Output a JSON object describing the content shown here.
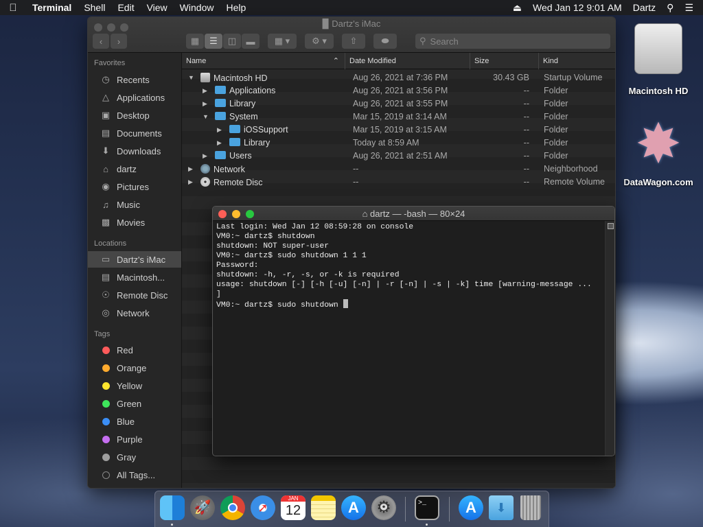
{
  "menubar": {
    "app": "Terminal",
    "items": [
      "Shell",
      "Edit",
      "View",
      "Window",
      "Help"
    ],
    "clock": "Wed Jan 12  9:01 AM",
    "user": "Dartz"
  },
  "finder": {
    "title": "Dartz's iMac",
    "search_placeholder": "Search",
    "sidebar": {
      "favorites_label": "Favorites",
      "favorites": [
        "Recents",
        "Applications",
        "Desktop",
        "Documents",
        "Downloads",
        "dartz",
        "Pictures",
        "Music",
        "Movies"
      ],
      "locations_label": "Locations",
      "locations": [
        "Dartz's iMac",
        "Macintosh...",
        "Remote Disc",
        "Network"
      ],
      "tags_label": "Tags",
      "tags": [
        {
          "name": "Red",
          "color": "#ff5b5b"
        },
        {
          "name": "Orange",
          "color": "#ffab2e"
        },
        {
          "name": "Yellow",
          "color": "#ffe52e"
        },
        {
          "name": "Green",
          "color": "#3ee65b"
        },
        {
          "name": "Blue",
          "color": "#3b8ef5"
        },
        {
          "name": "Purple",
          "color": "#c56ef0"
        },
        {
          "name": "Gray",
          "color": "#9e9e9e"
        }
      ],
      "all_tags": "All Tags..."
    },
    "columns": {
      "name": "Name",
      "date": "Date Modified",
      "size": "Size",
      "kind": "Kind"
    },
    "rows": [
      {
        "name": "Macintosh HD",
        "date": "Aug 26, 2021 at 7:36 PM",
        "size": "30.43 GB",
        "kind": "Startup Volume",
        "icon": "disk-icon",
        "expanded": true
      },
      {
        "name": "Applications",
        "date": "Aug 26, 2021 at 3:56 PM",
        "size": "--",
        "kind": "Folder",
        "icon": "folder-icon",
        "expanded": false
      },
      {
        "name": "Library",
        "date": "Aug 26, 2021 at 3:55 PM",
        "size": "--",
        "kind": "Folder",
        "icon": "folder-icon",
        "expanded": false
      },
      {
        "name": "System",
        "date": "Mar 15, 2019 at 3:14 AM",
        "size": "--",
        "kind": "Folder",
        "icon": "folder-icon",
        "expanded": true
      },
      {
        "name": "iOSSupport",
        "date": "Mar 15, 2019 at 3:15 AM",
        "size": "--",
        "kind": "Folder",
        "icon": "folder-icon",
        "expanded": false
      },
      {
        "name": "Library",
        "date": "Today at 8:59 AM",
        "size": "--",
        "kind": "Folder",
        "icon": "folder-icon",
        "expanded": false
      },
      {
        "name": "Users",
        "date": "Aug 26, 2021 at 2:51 AM",
        "size": "--",
        "kind": "Folder",
        "icon": "folder-icon",
        "expanded": false
      },
      {
        "name": "Network",
        "date": "--",
        "size": "--",
        "kind": "Neighborhood",
        "icon": "globe-icon",
        "expanded": false
      },
      {
        "name": "Remote Disc",
        "date": "--",
        "size": "--",
        "kind": "Remote Volume",
        "icon": "disc-icon",
        "expanded": false
      }
    ]
  },
  "terminal": {
    "title": "dartz — -bash — 80×24",
    "lines": [
      "Last login: Wed Jan 12 08:59:28 on console",
      "VM0:~ dartz$ shutdown",
      "shutdown: NOT super-user",
      "VM0:~ dartz$ sudo shutdown 1 1 1",
      "Password:",
      "shutdown: -h, -r, -s, or -k is required",
      "usage: shutdown [-] [-h [-u] [-n] | -r [-n] | -s | -k] time [warning-message ...",
      "]",
      "VM0:~ dartz$ sudo shutdown "
    ]
  },
  "desktop": {
    "icons": [
      "Macintosh HD",
      "DataWagon.com"
    ]
  },
  "dock": {
    "calendar_month": "JAN",
    "calendar_day": "12",
    "apps": [
      "finder-icon",
      "launchpad-icon",
      "chrome-icon",
      "safari-icon",
      "calendar-icon",
      "notes-icon",
      "app-store-icon",
      "system-preferences-icon",
      "terminal-icon",
      "app-store-download-icon",
      "downloads-folder-icon",
      "trash-icon"
    ]
  }
}
